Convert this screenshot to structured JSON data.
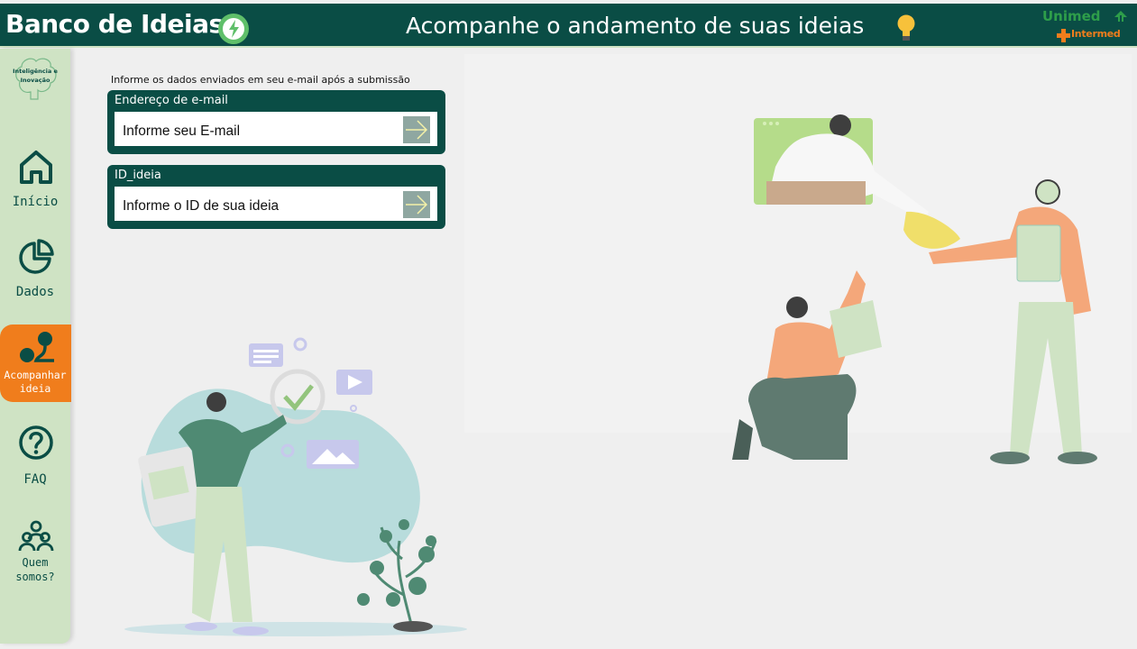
{
  "header": {
    "app_title": "Banco de Ideias",
    "subtitle": "Acompanhe o andamento de suas ideias",
    "brand_unimed": "Unimed",
    "brand_intermed": "Intermed"
  },
  "sidebar": {
    "logo_text": "Inteligência e Inovação",
    "items": [
      {
        "label": "Início",
        "icon": "home-icon"
      },
      {
        "label": "Dados",
        "icon": "pie-chart-icon"
      },
      {
        "label": "Acompanhar ideia",
        "icon": "track-idea-icon"
      },
      {
        "label": "FAQ",
        "icon": "question-icon"
      },
      {
        "label": "Quem somos?",
        "icon": "team-icon"
      }
    ]
  },
  "form": {
    "instruction": "Informe os dados enviados em seu e-mail após a submissão",
    "email": {
      "label": "Endereço de e-mail",
      "placeholder": "Informe seu E-mail",
      "value": ""
    },
    "idea_id": {
      "label": "ID_ideia",
      "placeholder": "Informe o ID de sua ideia",
      "value": ""
    }
  },
  "colors": {
    "primary": "#0a4d45",
    "sidebar_bg": "#cfe3c4",
    "accent": "#f07d1c",
    "brand_green": "#2e9e4a"
  }
}
